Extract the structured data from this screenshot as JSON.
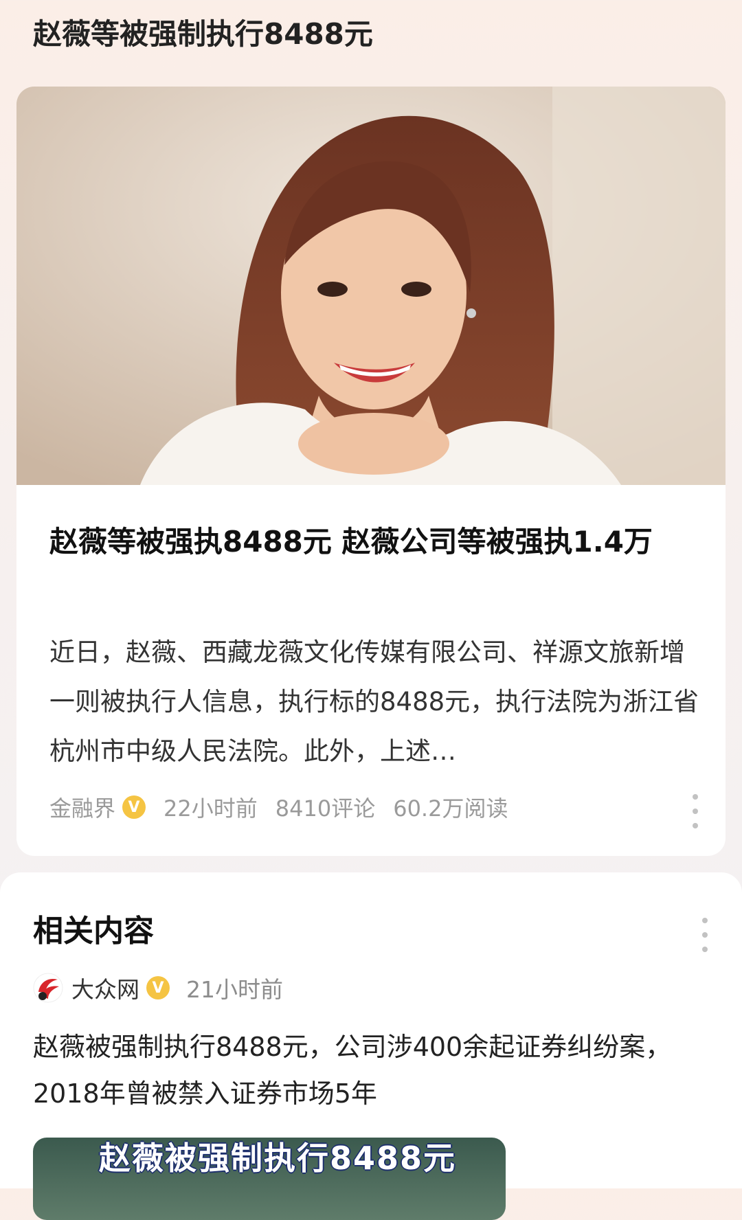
{
  "page": {
    "title": "赵薇等被强制执行8488元"
  },
  "article": {
    "title": "赵薇等被强执8488元 赵薇公司等被强执1.4万",
    "summary": "近日，赵薇、西藏龙薇文化传媒有限公司、祥源文旅新增一则被执行人信息，执行标的8488元，执行法院为浙江省杭州市中级人民法院。此外，上述…",
    "source": "金融界",
    "verified_badge": "V",
    "time": "22小时前",
    "comments": "8410评论",
    "reads": "60.2万阅读",
    "image_icon": "portrait-photo"
  },
  "related": {
    "heading": "相关内容",
    "source": "大众网",
    "verified_badge": "V",
    "time": "21小时前",
    "headline": "赵薇被强制执行8488元，公司涉400余起证券纠纷案，2018年曾被禁入证券市场5年",
    "thumb_caption": "赵薇被强制执行8488元"
  },
  "colors": {
    "badge": "#f5c443",
    "meta_text": "#9a9a9a",
    "logo_red": "#d8262b"
  }
}
